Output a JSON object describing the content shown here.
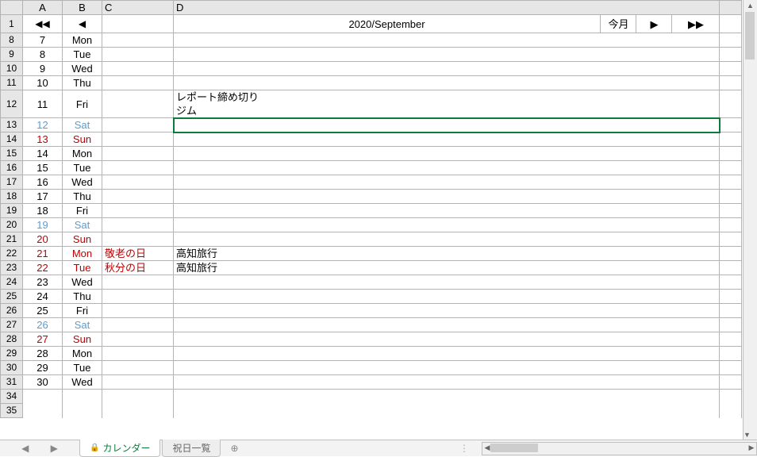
{
  "cols": {
    "A": "A",
    "B": "B",
    "C": "C",
    "D": "D"
  },
  "title_row": {
    "back_fast": "◀◀",
    "back": "◀",
    "title": "2020/September",
    "today": "今月",
    "fwd": "▶",
    "fwd_fast": "▶▶"
  },
  "rows": [
    {
      "n": "8",
      "d": "7",
      "w": "Mon",
      "cls": "",
      "hol": "",
      "ev": ""
    },
    {
      "n": "9",
      "d": "8",
      "w": "Tue",
      "cls": "",
      "hol": "",
      "ev": ""
    },
    {
      "n": "10",
      "d": "9",
      "w": "Wed",
      "cls": "",
      "hol": "",
      "ev": ""
    },
    {
      "n": "11",
      "d": "10",
      "w": "Thu",
      "cls": "",
      "hol": "",
      "ev": ""
    },
    {
      "n": "12",
      "d": "11",
      "w": "Fri",
      "cls": "",
      "hol": "",
      "ev": "レポート締め切り\nジム",
      "tall": true
    },
    {
      "n": "13",
      "d": "12",
      "w": "Sat",
      "cls": "sat",
      "hol": "",
      "ev": "",
      "sel": true
    },
    {
      "n": "14",
      "d": "13",
      "w": "Sun",
      "cls": "sun",
      "hol": "",
      "ev": ""
    },
    {
      "n": "15",
      "d": "14",
      "w": "Mon",
      "cls": "",
      "hol": "",
      "ev": ""
    },
    {
      "n": "16",
      "d": "15",
      "w": "Tue",
      "cls": "",
      "hol": "",
      "ev": ""
    },
    {
      "n": "17",
      "d": "16",
      "w": "Wed",
      "cls": "",
      "hol": "",
      "ev": ""
    },
    {
      "n": "18",
      "d": "17",
      "w": "Thu",
      "cls": "",
      "hol": "",
      "ev": ""
    },
    {
      "n": "19",
      "d": "18",
      "w": "Fri",
      "cls": "",
      "hol": "",
      "ev": ""
    },
    {
      "n": "20",
      "d": "19",
      "w": "Sat",
      "cls": "sat",
      "hol": "",
      "ev": ""
    },
    {
      "n": "21",
      "d": "20",
      "w": "Sun",
      "cls": "sun",
      "hol": "",
      "ev": ""
    },
    {
      "n": "22",
      "d": "21",
      "w": "Mon",
      "cls": "hol",
      "hol": "敬老の日",
      "ev": "高知旅行"
    },
    {
      "n": "23",
      "d": "22",
      "w": "Tue",
      "cls": "hol",
      "hol": "秋分の日",
      "ev": "高知旅行"
    },
    {
      "n": "24",
      "d": "23",
      "w": "Wed",
      "cls": "",
      "hol": "",
      "ev": ""
    },
    {
      "n": "25",
      "d": "24",
      "w": "Thu",
      "cls": "",
      "hol": "",
      "ev": ""
    },
    {
      "n": "26",
      "d": "25",
      "w": "Fri",
      "cls": "",
      "hol": "",
      "ev": ""
    },
    {
      "n": "27",
      "d": "26",
      "w": "Sat",
      "cls": "sat",
      "hol": "",
      "ev": ""
    },
    {
      "n": "28",
      "d": "27",
      "w": "Sun",
      "cls": "sun",
      "hol": "",
      "ev": ""
    },
    {
      "n": "29",
      "d": "28",
      "w": "Mon",
      "cls": "",
      "hol": "",
      "ev": ""
    },
    {
      "n": "30",
      "d": "29",
      "w": "Tue",
      "cls": "",
      "hol": "",
      "ev": ""
    },
    {
      "n": "31",
      "d": "30",
      "w": "Wed",
      "cls": "",
      "hol": "",
      "ev": ""
    }
  ],
  "blank_rows": [
    "34",
    "35"
  ],
  "tabs": {
    "active": "カレンダー",
    "inactive": "祝日一覧"
  }
}
